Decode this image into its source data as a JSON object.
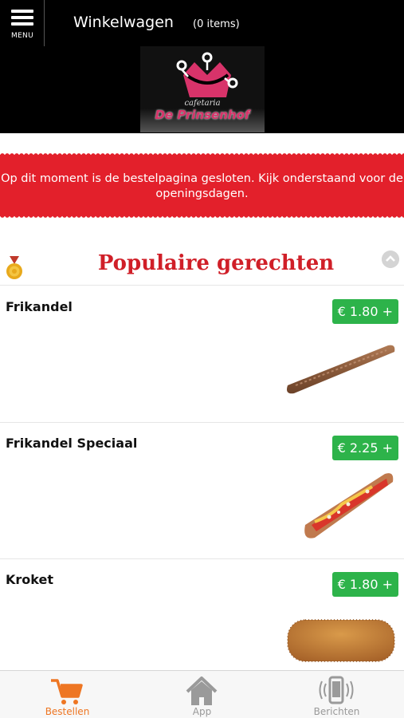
{
  "header": {
    "menu_label": "MENU",
    "cart_title": "Winkelwagen",
    "cart_count": "(0 items)",
    "logo_subtitle": "cafetaria",
    "logo_name": "De Prinsenhof"
  },
  "banner": {
    "message": "Op dit moment is de bestelpagina gesloten. Kijk onderstaand voor de openingsdagen."
  },
  "section": {
    "title": "Populaire gerechten",
    "icon": "medal-icon",
    "collapse_icon": "chevron-up-icon"
  },
  "products": [
    {
      "name": "Frikandel",
      "price": "€ 1.80 +",
      "image": "frikandel-image"
    },
    {
      "name": "Frikandel Speciaal",
      "price": "€ 2.25 +",
      "image": "frikandel-speciaal-image"
    },
    {
      "name": "Kroket",
      "price": "€ 1.80 +",
      "image": "kroket-image"
    }
  ],
  "tabs": [
    {
      "label": "Bestellen",
      "icon": "cart-icon",
      "active": true
    },
    {
      "label": "App",
      "icon": "home-icon",
      "active": false
    },
    {
      "label": "Berichten",
      "icon": "phone-vibrate-icon",
      "active": false
    }
  ],
  "colors": {
    "accent": "#e3202b",
    "price_green": "#2db34a",
    "active_tab": "#ee7623",
    "title_red": "#d01f28"
  }
}
